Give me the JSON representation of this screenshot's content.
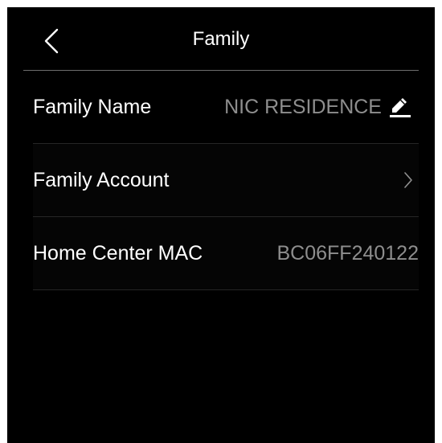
{
  "header": {
    "title": "Family",
    "back_icon": "chevron-left-icon"
  },
  "rows": [
    {
      "label": "Family Name",
      "value": "NIC RESIDENCE",
      "icon": "pencil-edit-icon"
    },
    {
      "label": "Family Account",
      "value": "",
      "icon": "chevron-right-icon"
    },
    {
      "label": "Home Center MAC",
      "value": "BC06FF240122"
    }
  ],
  "colors": {
    "background": "#000000",
    "primary_text": "#ffffff",
    "secondary_text": "#8e8e8e",
    "divider": "#6e6e6e",
    "row_divider": "#262626"
  }
}
